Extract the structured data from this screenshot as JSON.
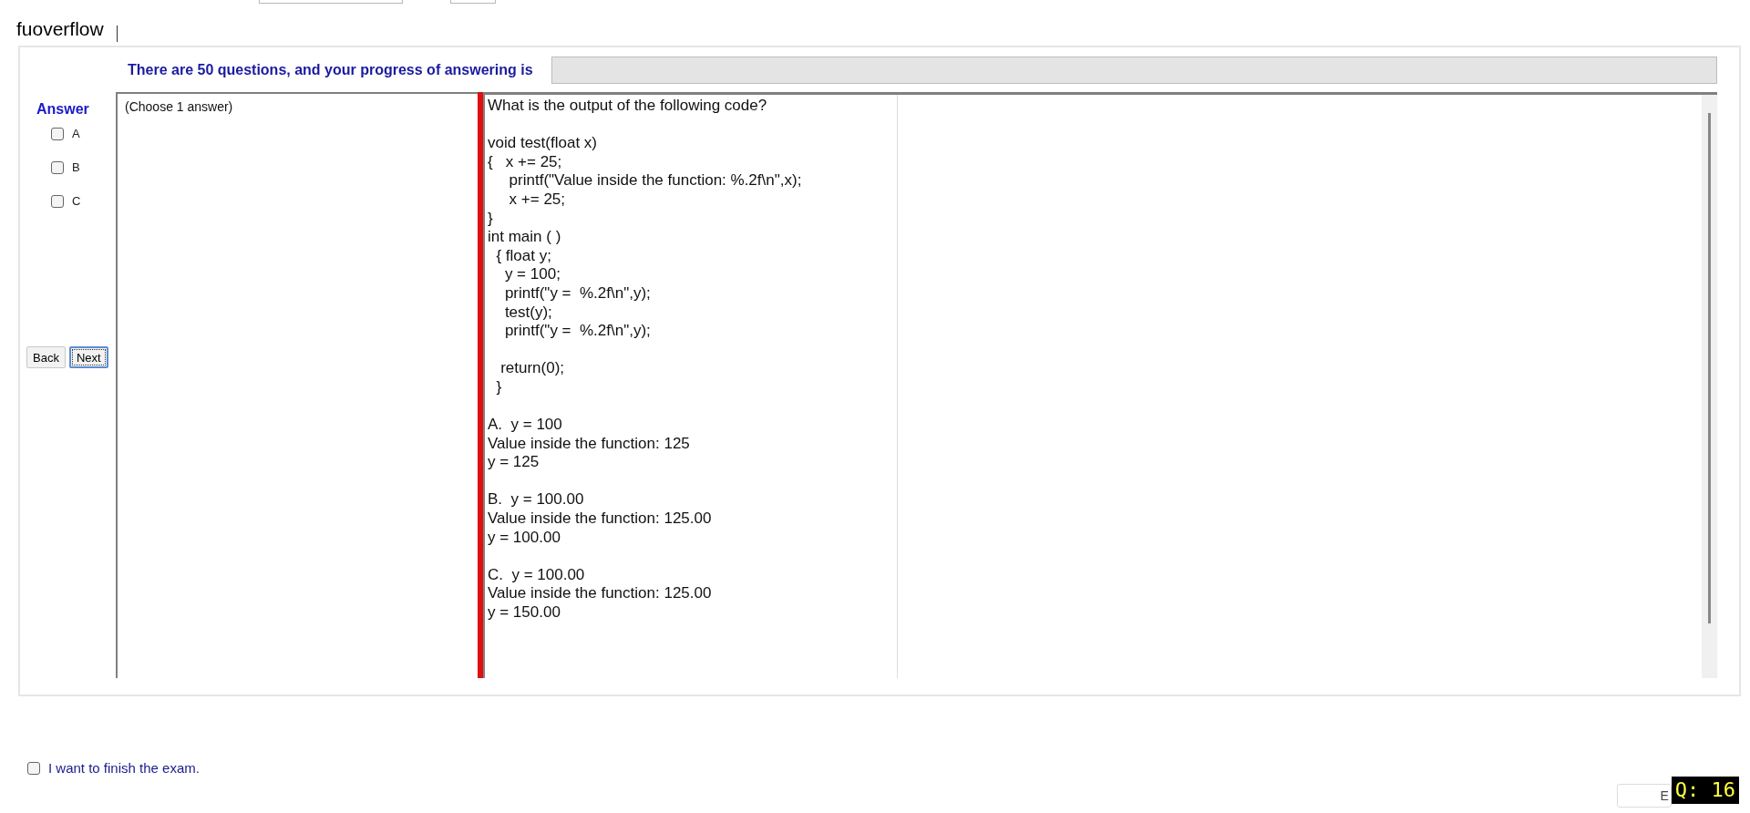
{
  "header": {
    "site_name": "fuoverflow"
  },
  "progress": {
    "text": "There are 50 questions, and your progress of answering is"
  },
  "answer_panel": {
    "title": "Answer",
    "options": [
      {
        "label": "A",
        "checked": false
      },
      {
        "label": "B",
        "checked": false
      },
      {
        "label": "C",
        "checked": false
      }
    ],
    "buttons": [
      {
        "label": "Back",
        "focused": false
      },
      {
        "label": "Next",
        "focused": true
      }
    ]
  },
  "instruction": "(Choose 1 answer)",
  "question": {
    "paragraphs": [
      [
        "What is the output of the following code?"
      ],
      [
        "void test(float x)",
        "{   x += 25;",
        "     printf(\"Value inside the function: %.2f\\n\",x);",
        "     x += 25;",
        "}",
        "int main ( )",
        "  { float y;",
        "    y = 100;",
        "    printf(\"y =  %.2f\\n\",y);",
        "    test(y);",
        "    printf(\"y =  %.2f\\n\",y);"
      ],
      [
        "   return(0);",
        "  }"
      ],
      [
        "A.  y = 100",
        "Value inside the function: 125",
        "y = 125"
      ],
      [
        "B.  y = 100.00",
        "Value inside the function: 125.00",
        "y = 100.00"
      ],
      [
        "C.  y = 100.00",
        "Value inside the function: 125.00",
        "y = 150.00"
      ]
    ]
  },
  "finish": {
    "label": "I want to finish the exam.",
    "checked": false
  },
  "exit_button": {
    "label": "E"
  },
  "question_counter": "Q: 16"
}
